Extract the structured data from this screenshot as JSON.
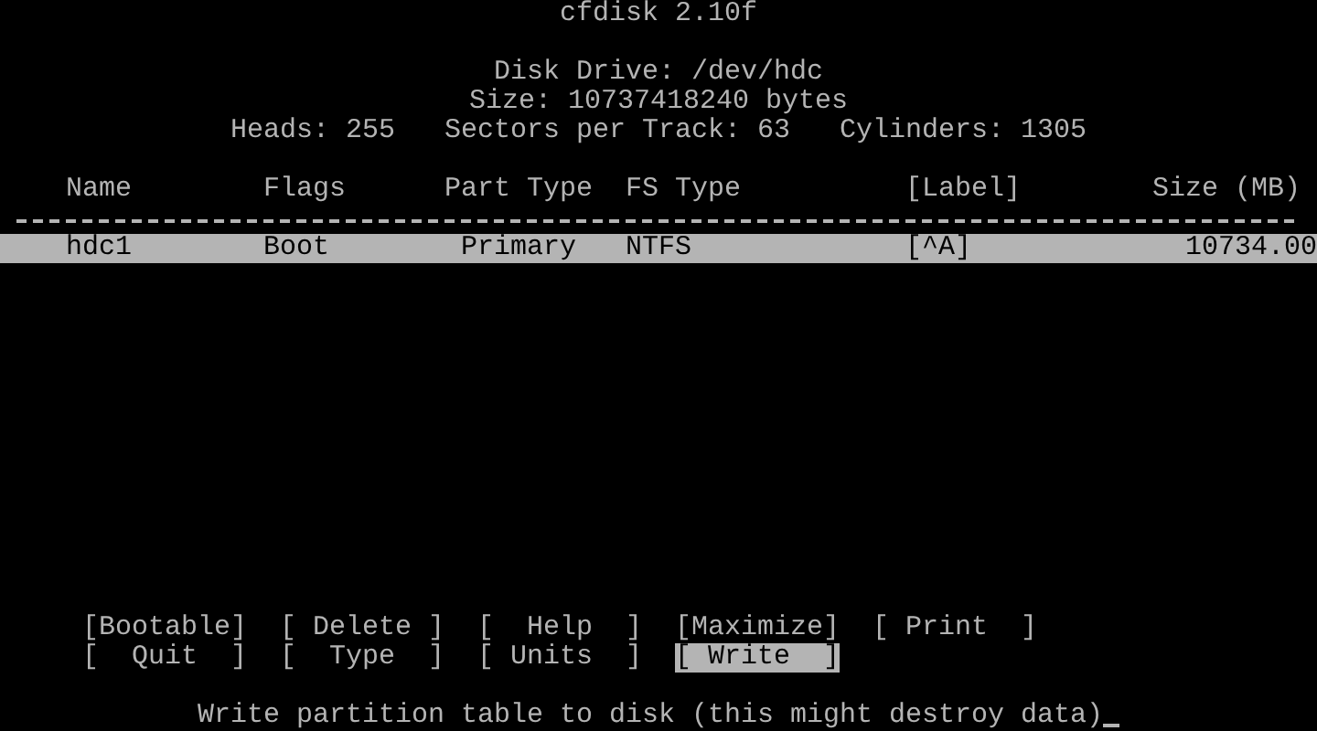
{
  "title": "cfdisk 2.10f",
  "disk_info": [
    "Disk Drive: /dev/hdc",
    "Size: 10737418240 bytes",
    "Heads: 255   Sectors per Track: 63   Cylinders: 1305"
  ],
  "table": {
    "columns": [
      "Name",
      "Flags",
      "Part Type",
      "FS Type",
      "[Label]",
      "Size (MB)"
    ],
    "rows": [
      {
        "selected": true,
        "cells": [
          "hdc1",
          "Boot",
          "Primary",
          "NTFS",
          "[^A]",
          "10734.00"
        ]
      }
    ]
  },
  "menu": [
    [
      {
        "label": "[Bootable]",
        "selected": false
      },
      {
        "label": "[ Delete ]",
        "selected": false
      },
      {
        "label": "[  Help  ]",
        "selected": false
      },
      {
        "label": "[Maximize]",
        "selected": false
      },
      {
        "label": "[ Print  ]",
        "selected": false
      }
    ],
    [
      {
        "label": "[  Quit  ]",
        "selected": false
      },
      {
        "label": "[  Type  ]",
        "selected": false
      },
      {
        "label": "[ Units  ]",
        "selected": false
      },
      {
        "label": "[ Write  ]",
        "selected": true
      }
    ]
  ],
  "status_message": "Write partition table to disk (this might destroy data)"
}
